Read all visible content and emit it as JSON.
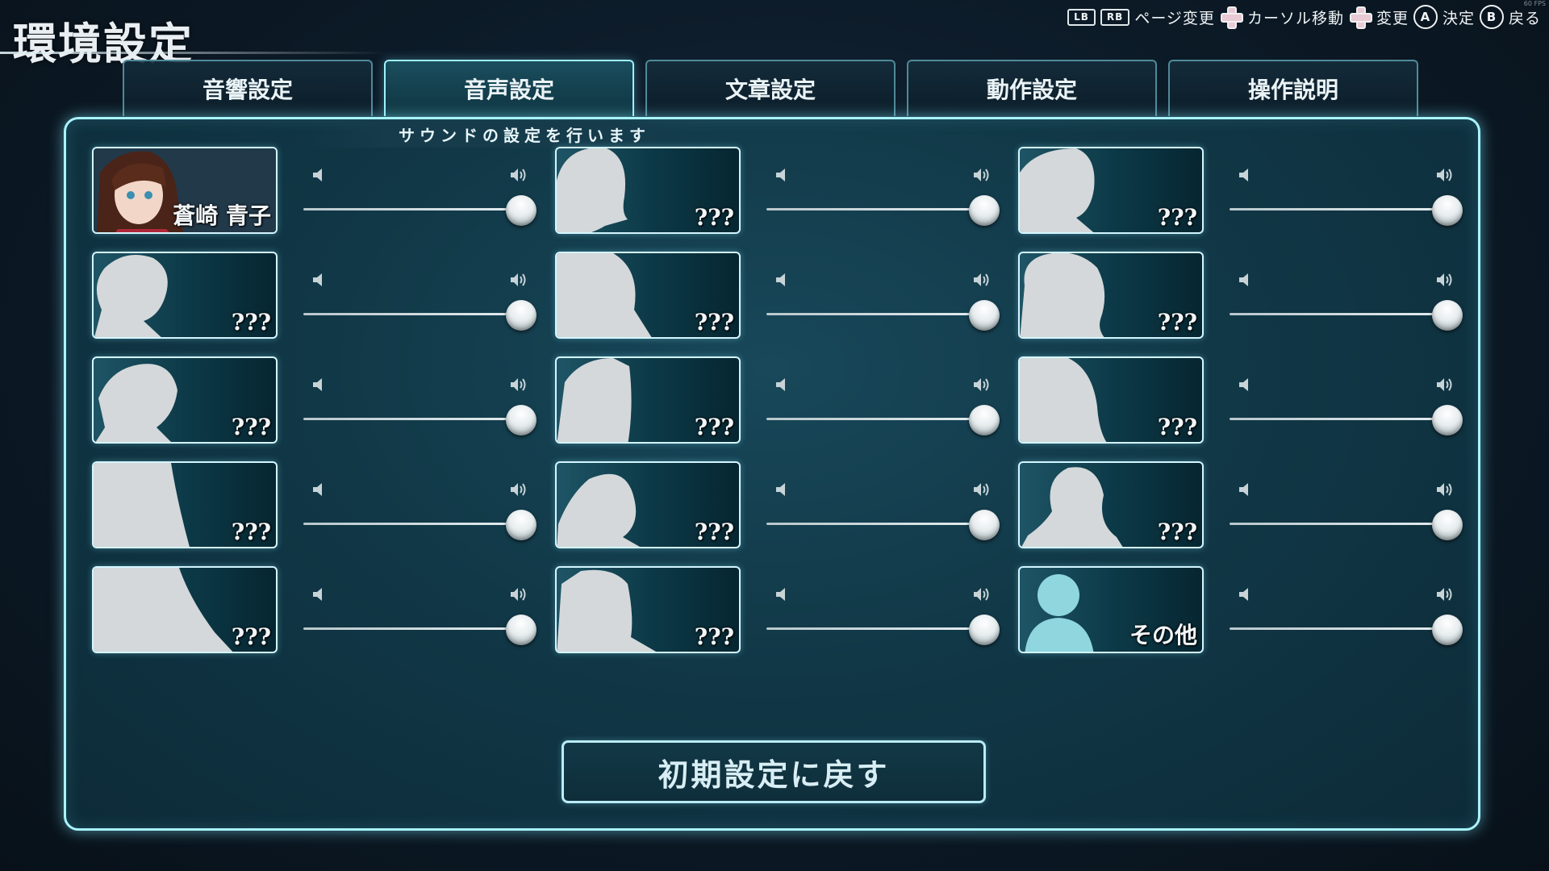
{
  "screen": {
    "title": "環境設定",
    "fps_label": "60 FPS"
  },
  "hints": {
    "page_keys": [
      "LB",
      "RB"
    ],
    "page_change": "ページ変更",
    "cursor_move": "カーソル移動",
    "change": "変更",
    "confirm_button": "A",
    "confirm": "決定",
    "back_button": "B",
    "back": "戻る"
  },
  "tabs": [
    {
      "label": "音響設定",
      "active": false
    },
    {
      "label": "音声設定",
      "active": true
    },
    {
      "label": "文章設定",
      "active": false
    },
    {
      "label": "動作設定",
      "active": false
    },
    {
      "label": "操作説明",
      "active": false
    }
  ],
  "panel": {
    "subtitle": "サウンドの設定を行います"
  },
  "voices": [
    {
      "name": "蒼崎 青子",
      "volume": 1.0,
      "icon": "aoko-portrait"
    },
    {
      "name": "???",
      "volume": 1.0,
      "icon": "silhouette-icon"
    },
    {
      "name": "???",
      "volume": 1.0,
      "icon": "silhouette-icon"
    },
    {
      "name": "???",
      "volume": 1.0,
      "icon": "silhouette-icon"
    },
    {
      "name": "???",
      "volume": 1.0,
      "icon": "silhouette-icon"
    },
    {
      "name": "???",
      "volume": 1.0,
      "icon": "silhouette-icon"
    },
    {
      "name": "???",
      "volume": 1.0,
      "icon": "silhouette-icon"
    },
    {
      "name": "???",
      "volume": 1.0,
      "icon": "silhouette-icon"
    },
    {
      "name": "???",
      "volume": 1.0,
      "icon": "silhouette-icon"
    },
    {
      "name": "???",
      "volume": 1.0,
      "icon": "silhouette-icon"
    },
    {
      "name": "???",
      "volume": 1.0,
      "icon": "silhouette-icon"
    },
    {
      "name": "???",
      "volume": 1.0,
      "icon": "silhouette-icon"
    },
    {
      "name": "???",
      "volume": 1.0,
      "icon": "silhouette-icon"
    },
    {
      "name": "???",
      "volume": 1.0,
      "icon": "silhouette-icon"
    },
    {
      "name": "その他",
      "volume": 1.0,
      "icon": "generic-person-icon"
    }
  ],
  "reset": {
    "label": "初期設定に戻す"
  },
  "colors": {
    "accent": "#a8f4ff",
    "panel": "#113847",
    "background": "#0c1a27"
  }
}
